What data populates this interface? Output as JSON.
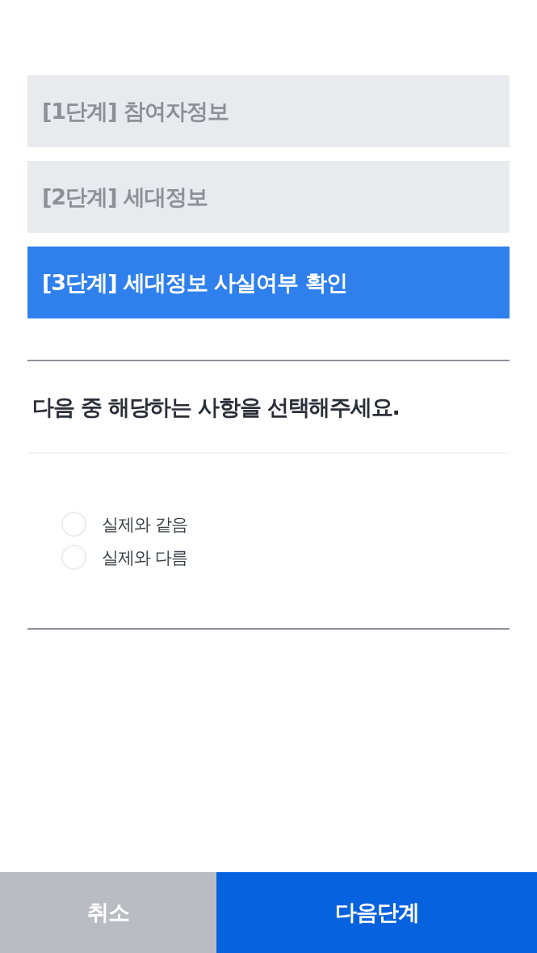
{
  "steps": [
    {
      "label": "[1단계] 참여자정보",
      "selected": false
    },
    {
      "label": "[2단계] 세대정보",
      "selected": false
    },
    {
      "label": "[3단계] 세대정보 사실여부 확인",
      "selected": true
    }
  ],
  "question": "다음 중 해당하는 사항을 선택해주세요.",
  "options": [
    {
      "label": "실제와 같음",
      "selected": false
    },
    {
      "label": "실제와 다름",
      "selected": false
    }
  ],
  "footer_buttons": [
    {
      "label": "취소",
      "kind": "cancel"
    },
    {
      "label": "다음단계",
      "kind": "primary"
    }
  ]
}
